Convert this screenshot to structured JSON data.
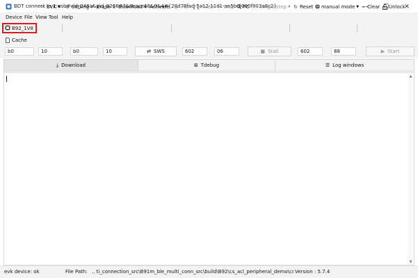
{
  "window": {
    "title": "BDT connect to 1:usb#vid_248a&pid_8266#7&9cace68&0&4#{28d78fad-5a12-11d1-ae5b-0000f803a8c2}",
    "controls": {
      "minimize": "—",
      "maximize": "☐",
      "close": "✕"
    }
  },
  "menu": [
    "Device",
    "File",
    "View",
    "Tool",
    "Help"
  ],
  "toolbar": {
    "chip": "B92_1V8",
    "board": "EVK",
    "setting": "Setting",
    "erase": "Erase",
    "download": "Download",
    "activate": "Activate",
    "run": "Run",
    "pause": "Pause",
    "step": "Step",
    "pc": "PC",
    "single_step": "Single step",
    "reset": "Reset",
    "manual_mode": "manual mode",
    "clear": "Clear",
    "unlock": "Unlock",
    "cache": "Cache"
  },
  "address_row": {
    "field1": "b0",
    "field2": "10",
    "field3": "b0",
    "field4": "10",
    "sws_button": "SWS",
    "field5": "602",
    "field6": "06",
    "stall_button": "Stall",
    "field7": "602",
    "field8": "88",
    "start_button": "Start"
  },
  "tabs": [
    "Download",
    "Tdebug",
    "Log windows"
  ],
  "status": {
    "device": "evk device: ok",
    "file_path_label": "File Path:",
    "file_path": "..  ti_connection_src\\B91m_ble_multi_conn_src\\build\\B92\\cs_acl_peripheral_demo\\cs",
    "version": "Version : 5.7.4"
  },
  "colors": {
    "highlight_border": "#e01818",
    "chrome_bg": "#f3f3f3",
    "content_bg": "#ffffff"
  },
  "icons": {
    "chip": "chip-icon",
    "setting": "gear-icon",
    "erase": "eraser-icon",
    "download": "download-icon",
    "activate": "plus-icon",
    "run": "play-icon",
    "pause": "pause-icon",
    "step": "step-icon",
    "pc": "search-icon",
    "reset": "reset-icon",
    "manual_mode": "globe-icon",
    "clear": "broom-icon",
    "unlock": "unlock-icon",
    "cache": "document-icon"
  }
}
